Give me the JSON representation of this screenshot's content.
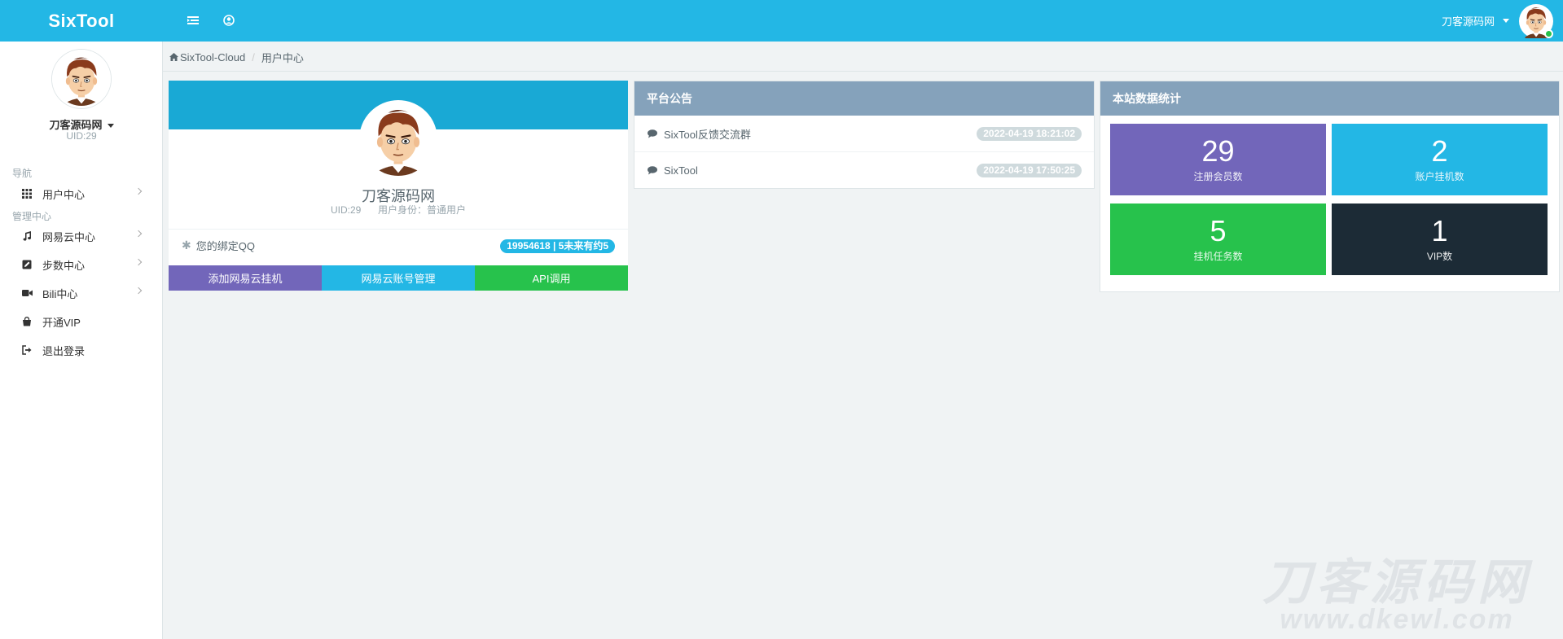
{
  "header": {
    "brand": "SixTool",
    "user_name": "刀客源码网"
  },
  "sidebar": {
    "user_name": "刀客源码网",
    "uid": "UID:29",
    "section_nav": "导航",
    "section_admin": "管理中心",
    "items": [
      {
        "label": "用户中心",
        "icon": "grid-icon"
      },
      {
        "label": "网易云中心",
        "icon": "music-icon"
      },
      {
        "label": "步数中心",
        "icon": "edit-icon"
      },
      {
        "label": "Bili中心",
        "icon": "video-icon"
      },
      {
        "label": "开通VIP",
        "icon": "shopping-bag-icon"
      },
      {
        "label": "退出登录",
        "icon": "sign-out-icon"
      }
    ]
  },
  "breadcrumb": {
    "root": "SixTool-Cloud",
    "current": "用户中心"
  },
  "profile": {
    "name": "刀客源码网",
    "uid": "UID:29",
    "role": "用户身份：普通用户",
    "qq_label": "您的绑定QQ",
    "qq_value": "19954618 | 5未来有约5",
    "buttons": [
      {
        "label": "添加网易云挂机",
        "color": "#7266ba"
      },
      {
        "label": "网易云账号管理",
        "color": "#23b7e5"
      },
      {
        "label": "API调用",
        "color": "#27c24c"
      }
    ]
  },
  "notice": {
    "title": "平台公告",
    "items": [
      {
        "text": "SixTool反馈交流群",
        "time": "2022-04-19 18:21:02"
      },
      {
        "text": "SixTool",
        "time": "2022-04-19 17:50:25"
      }
    ]
  },
  "stats": {
    "title": "本站数据统计",
    "boxes": [
      {
        "value": "29",
        "label": "注册会员数",
        "color": "#7266ba"
      },
      {
        "value": "2",
        "label": "账户挂机数",
        "color": "#23b7e5"
      },
      {
        "value": "5",
        "label": "挂机任务数",
        "color": "#27c24c"
      },
      {
        "value": "1",
        "label": "VIP数",
        "color": "#1c2b36"
      }
    ]
  },
  "watermark": {
    "cn": "刀客源码网",
    "en": "www.dkewl.com"
  }
}
